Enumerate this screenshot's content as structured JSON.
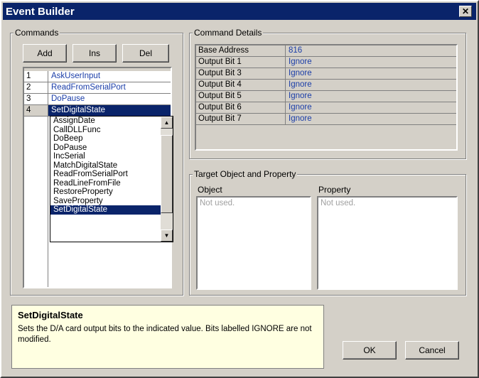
{
  "window": {
    "title": "Event Builder",
    "close_glyph": "✕"
  },
  "commands": {
    "group_label": "Commands",
    "buttons": {
      "add": "Add",
      "ins": "Ins",
      "del": "Del"
    },
    "rows": [
      {
        "num": "1",
        "name": "AskUserInput"
      },
      {
        "num": "2",
        "name": "ReadFromSerialPort"
      },
      {
        "num": "3",
        "name": "DoPause"
      },
      {
        "num": "4",
        "name": "SetDigitalState"
      }
    ],
    "dropdown_options": [
      "AssignDate",
      "CallDLLFunc",
      "DoBeep",
      "DoPause",
      "IncSerial",
      "MatchDigitalState",
      "ReadFromSerialPort",
      "ReadLineFromFile",
      "RestoreProperty",
      "SaveProperty",
      "SetDigitalState"
    ],
    "dropdown_selected": "SetDigitalState"
  },
  "details": {
    "group_label": "Command Details",
    "rows": [
      {
        "key": "Base Address",
        "value": "816"
      },
      {
        "key": "Output Bit 1",
        "value": "Ignore"
      },
      {
        "key": "Output Bit 3",
        "value": "Ignore"
      },
      {
        "key": "Output Bit 4",
        "value": "Ignore"
      },
      {
        "key": "Output Bit 5",
        "value": "Ignore"
      },
      {
        "key": "Output Bit 6",
        "value": "Ignore"
      },
      {
        "key": "Output Bit 7",
        "value": "Ignore"
      }
    ]
  },
  "target": {
    "group_label": "Target Object and Property",
    "object_label": "Object",
    "property_label": "Property",
    "object_value": "Not used.",
    "property_value": "Not used."
  },
  "info": {
    "title": "SetDigitalState",
    "description": "Sets the D/A card output bits to the indicated value. Bits labelled IGNORE are not modified."
  },
  "footer": {
    "ok": "OK",
    "cancel": "Cancel"
  },
  "colors": {
    "titlebar": "#0a246a",
    "info_bg": "#ffffe1",
    "link_text": "#1a3da8"
  }
}
